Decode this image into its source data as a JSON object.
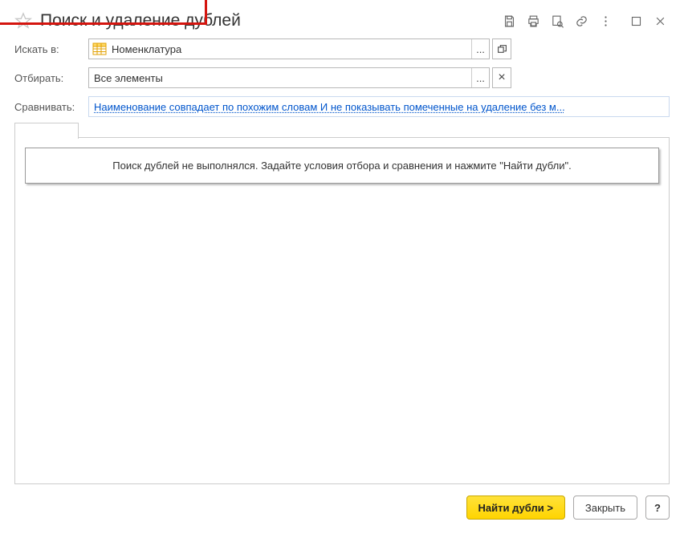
{
  "title": "Поиск и удаление дублей",
  "fields": {
    "searchIn": {
      "label": "Искать в:",
      "value": "Номенклатура"
    },
    "filter": {
      "label": "Отбирать:",
      "value": "Все элементы"
    },
    "compare": {
      "label": "Сравнивать:",
      "value": "Наименование совпадает по похожим словам И не показывать помеченные на удаление без м..."
    }
  },
  "notice": "Поиск дублей не выполнялся.  Задайте условия отбора и сравнения и нажмите \"Найти дубли\".",
  "buttons": {
    "find": "Найти дубли >",
    "close": "Закрыть",
    "help": "?"
  },
  "smallButtons": {
    "dots": "...",
    "clear": "×"
  }
}
